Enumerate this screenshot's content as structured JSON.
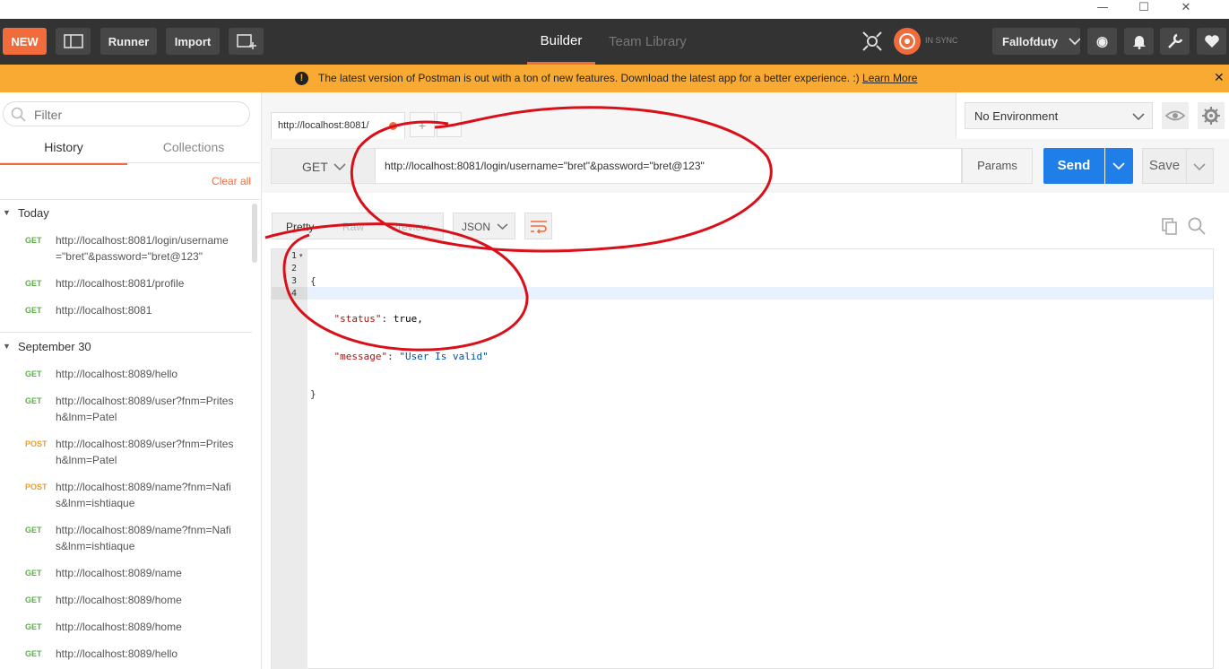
{
  "header": {
    "new_label": "NEW",
    "runner_label": "Runner",
    "import_label": "Import",
    "tab_builder": "Builder",
    "tab_team_library": "Team Library",
    "sync_label": "IN SYNC",
    "user_label": "Fallofduty",
    "accent": "#f26b3a"
  },
  "banner": {
    "message": "The latest version of Postman is out with a ton of new features. Download the latest app for a better experience. :)",
    "link": "Learn More",
    "close": "✕"
  },
  "sidebar": {
    "filter_placeholder": "Filter",
    "tab_history": "History",
    "tab_collections": "Collections",
    "clear_all": "Clear all",
    "groups": [
      {
        "title": "Today",
        "items": [
          {
            "method": "GET",
            "url": "http://localhost:8081/login/username=\"bret\"&password=\"bret@123\""
          },
          {
            "method": "GET",
            "url": "http://localhost:8081/profile"
          },
          {
            "method": "GET",
            "url": "http://localhost:8081"
          }
        ]
      },
      {
        "title": "September 30",
        "items": [
          {
            "method": "GET",
            "url": "http://localhost:8089/hello"
          },
          {
            "method": "GET",
            "url": "http://localhost:8089/user?fnm=Pritesh&lnm=Patel"
          },
          {
            "method": "POST",
            "url": "http://localhost:8089/user?fnm=Pritesh&lnm=Patel"
          },
          {
            "method": "POST",
            "url": "http://localhost:8089/name?fnm=Nafis&lnm=ishtiaque"
          },
          {
            "method": "GET",
            "url": "http://localhost:8089/name?fnm=Nafis&lnm=ishtiaque"
          },
          {
            "method": "GET",
            "url": "http://localhost:8089/name"
          },
          {
            "method": "GET",
            "url": "http://localhost:8089/home"
          },
          {
            "method": "GET",
            "url": "http://localhost:8089/home"
          },
          {
            "method": "GET",
            "url": "http://localhost:8089/hello"
          }
        ]
      }
    ]
  },
  "request": {
    "tab_label": "http://localhost:8081/",
    "add_tab": "+",
    "more_tabs": "•••",
    "environment": "No Environment",
    "method": "GET",
    "url": "http://localhost:8081/login/username=\"bret\"&password=\"bret@123\"",
    "params_label": "Params",
    "send_label": "Send",
    "save_label": "Save"
  },
  "response": {
    "view_pretty": "Pretty",
    "view_raw": "Raw",
    "view_preview": "Preview",
    "format": "JSON",
    "line_numbers": [
      "1",
      "2",
      "3",
      "4"
    ],
    "line1": "{",
    "line2_key": "\"status\"",
    "line2_val": "true,",
    "line3_key": "\"message\"",
    "line3_val": "\"User Is valid\"",
    "line4": "}"
  }
}
